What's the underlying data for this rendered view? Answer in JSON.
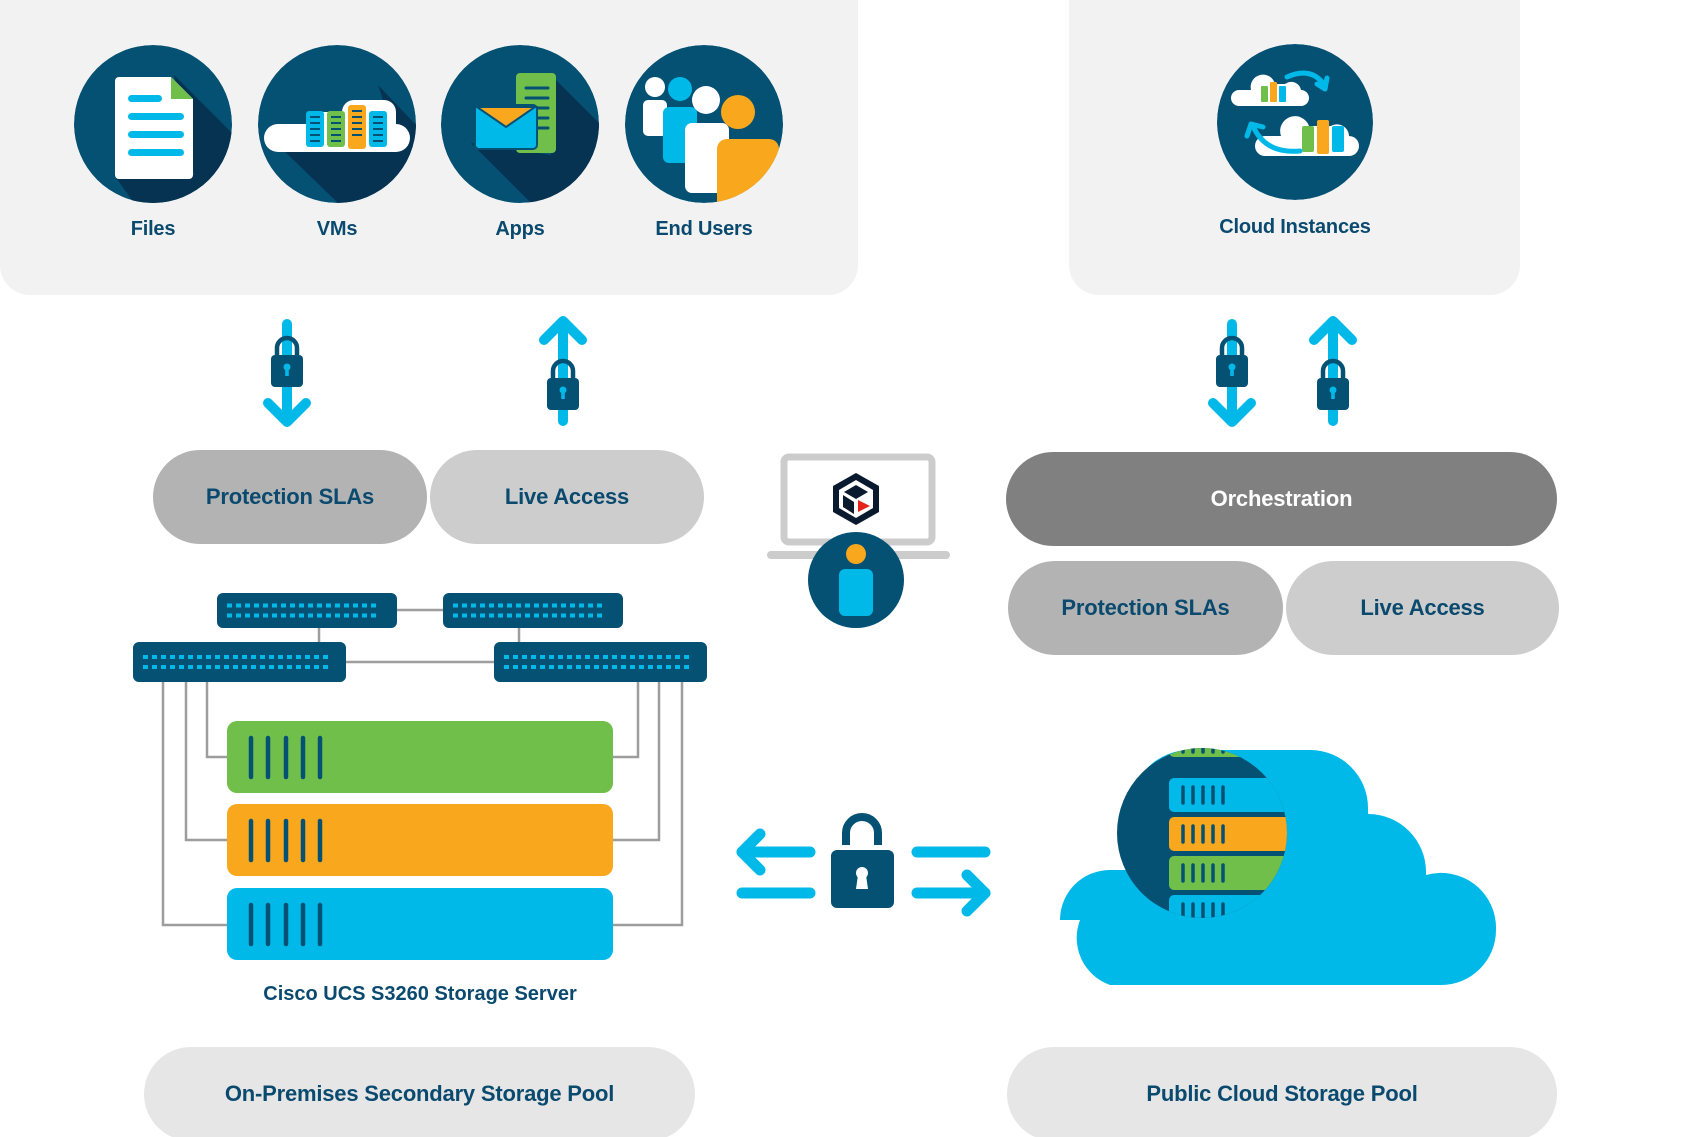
{
  "sources_panel": {
    "items": [
      {
        "label": "Files",
        "icon": "document-icon"
      },
      {
        "label": "VMs",
        "icon": "cloud-servers-icon"
      },
      {
        "label": "Apps",
        "icon": "email-app-icon"
      },
      {
        "label": "End Users",
        "icon": "users-group-icon"
      }
    ]
  },
  "cloud_panel": {
    "items": [
      {
        "label": "Cloud Instances",
        "icon": "cloud-sync-icon"
      }
    ]
  },
  "on_prem": {
    "pills": [
      {
        "label": "Protection SLAs"
      },
      {
        "label": "Live Access"
      }
    ],
    "server_label": "Cisco UCS S3260 Storage Server",
    "pool_label": "On-Premises Secondary Storage Pool",
    "servers": [
      {
        "color": "#70bf4b"
      },
      {
        "color": "#f9a81e"
      },
      {
        "color": "#00b9e8"
      }
    ]
  },
  "cloud_side": {
    "orchestration_label": "Orchestration",
    "pills": [
      {
        "label": "Protection SLAs"
      },
      {
        "label": "Live Access"
      }
    ],
    "pool_label": "Public Cloud Storage Pool"
  },
  "colors": {
    "navy": "#055174",
    "navy_shadow": "#063352",
    "cyan": "#00b9e8",
    "green": "#70bf4b",
    "orange": "#f9a81e",
    "label_text": "#0b4a6f",
    "red_accent": "#e3241b"
  },
  "connectors": {
    "secure_transfer_icon": "lock-icon",
    "direction_labels": [
      "down",
      "up",
      "down",
      "up"
    ]
  }
}
